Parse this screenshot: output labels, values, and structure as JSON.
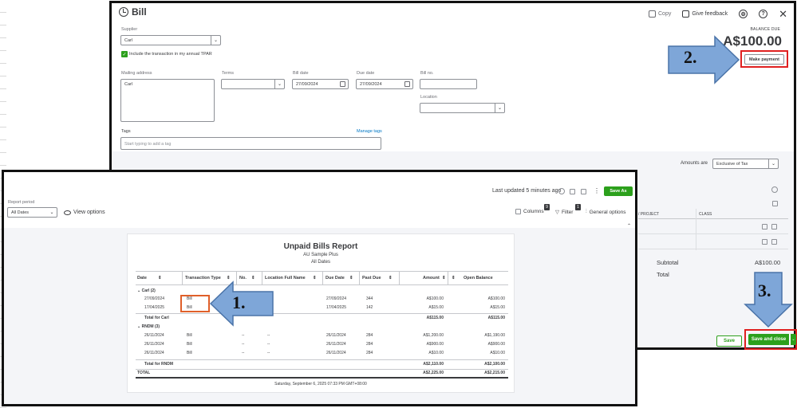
{
  "bill": {
    "title": "Bill",
    "copy_label": "Copy",
    "feedback_label": "Give feedback",
    "help_glyph": "?",
    "close_glyph": "✕",
    "supplier_label": "Supplier",
    "supplier_value": "Carl",
    "include_tpar_label": "Include the transaction in my annual TPAR",
    "mailing_address_label": "Mailing address",
    "mailing_address_value": "Carl",
    "terms_label": "Terms",
    "bill_date_label": "Bill date",
    "bill_date_value": "27/09/2024",
    "due_date_label": "Due date",
    "due_date_value": "27/09/2024",
    "bill_no_label": "Bill no.",
    "location_label": "Location",
    "tags_label": "Tags",
    "manage_tags_label": "Manage tags",
    "tags_placeholder": "Start typing to add a tag",
    "balance_due_label": "BALANCE DUE",
    "balance_due_value": "A$100.00",
    "make_payment_label": "Make payment",
    "amounts_are_label": "Amounts are",
    "amounts_are_value": "Exclusive of Tax",
    "col_project": "/ PROJECT",
    "col_class": "CLASS",
    "subtotal_label": "Subtotal",
    "subtotal_value": "A$100.00",
    "total_label": "Total",
    "save_label": "Save",
    "save_close_label": "Save and close"
  },
  "report": {
    "last_updated": "Last updated 5 minutes ago",
    "save_as_label": "Save As",
    "report_period_label": "Report period",
    "report_period_value": "All Dates",
    "view_options_label": "View options",
    "columns_label": "Columns",
    "columns_badge": "9",
    "filter_label": "Filter",
    "filter_badge": "1",
    "general_options_label": "General options",
    "title": "Unpaid Bills Report",
    "company": "AU Sample Plus",
    "period": "All Dates",
    "columns": [
      "Date",
      "Transaction Type",
      "No.",
      "Location Full Name",
      "Due Date",
      "Past Due",
      "Amount",
      "Open Balance"
    ],
    "groups": [
      {
        "name": "Carl (2)",
        "rows": [
          {
            "date": "27/09/2024",
            "type": "Bill",
            "no": "",
            "loc": "",
            "due": "27/09/2024",
            "past": "344",
            "amount": "A$100.00",
            "open": "A$100.00"
          },
          {
            "date": "17/04/2025",
            "type": "Bill",
            "no": "",
            "loc": "",
            "due": "17/04/2025",
            "past": "142",
            "amount": "A$15.00",
            "open": "A$15.00"
          }
        ],
        "total_label": "Total for Carl",
        "total_amount": "A$115.00",
        "total_open": "A$115.00"
      },
      {
        "name": "RNDM (3)",
        "rows": [
          {
            "date": "26/11/2024",
            "type": "Bill",
            "no": "--",
            "loc": "--",
            "due": "26/11/2024",
            "past": "284",
            "amount": "A$1,200.00",
            "open": "A$1,190.00"
          },
          {
            "date": "26/11/2024",
            "type": "Bill",
            "no": "--",
            "loc": "--",
            "due": "26/11/2024",
            "past": "284",
            "amount": "A$900.00",
            "open": "A$900.00"
          },
          {
            "date": "26/11/2024",
            "type": "Bill",
            "no": "--",
            "loc": "--",
            "due": "26/11/2024",
            "past": "284",
            "amount": "A$10.00",
            "open": "A$10.00"
          }
        ],
        "total_label": "Total for RNDM",
        "total_amount": "A$2,110.00",
        "total_open": "A$2,100.00"
      }
    ],
    "grand_total_label": "TOTAL",
    "grand_total_amount": "A$2,225.00",
    "grand_total_open": "A$2,215.00",
    "footer_timestamp": "Saturday, September 6, 2025 07:33 PM GMT+08:00"
  },
  "annotations": {
    "step1": "1.",
    "step2": "2.",
    "step3": "3.",
    "arrow_color": "#7ea6d8",
    "highlight_color": "#e02020"
  }
}
